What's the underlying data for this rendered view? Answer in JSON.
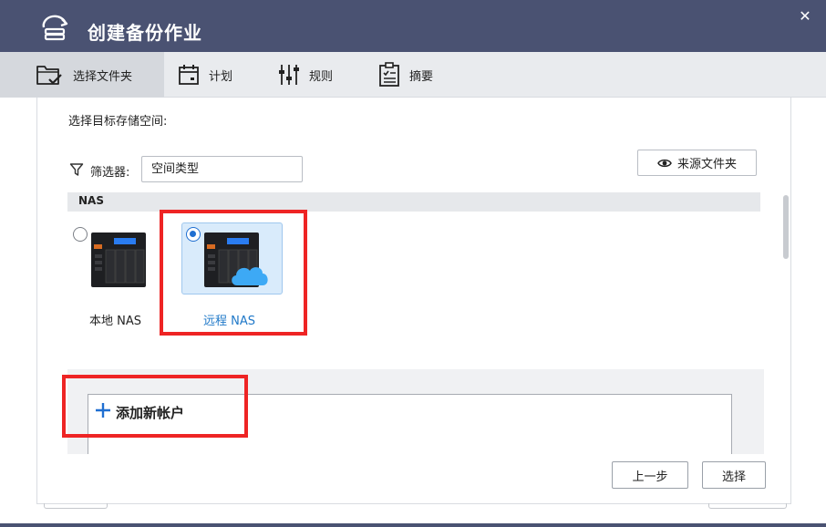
{
  "window": {
    "title": "创建备份作业",
    "title_bar_color": "#4a5272",
    "close_icon": "close-icon"
  },
  "steps": [
    {
      "label": "选择文件夹",
      "icon": "folder-check-icon",
      "active": true
    },
    {
      "label": "计划",
      "icon": "calendar-icon",
      "active": false
    },
    {
      "label": "规则",
      "icon": "sliders-icon",
      "active": false
    },
    {
      "label": "摘要",
      "icon": "clipboard-list-icon",
      "active": false
    }
  ],
  "main": {
    "heading": "选择目标存储空间:",
    "filter": {
      "label": "筛选器:",
      "value": "空间类型"
    },
    "source_folder_button": "来源文件夹",
    "section_label": "NAS",
    "nas_options": [
      {
        "label": "本地 NAS",
        "selected": false
      },
      {
        "label": "远程 NAS",
        "selected": true
      }
    ],
    "add_account": "添加新帐户"
  },
  "footer": {
    "back_label": "上一步",
    "select_label": "选择"
  },
  "colors": {
    "accent": "#1f6fd1",
    "selected_text": "#1f78c8",
    "highlight_box": "#ee2424",
    "card_selected_bg": "#d9ebfb"
  }
}
